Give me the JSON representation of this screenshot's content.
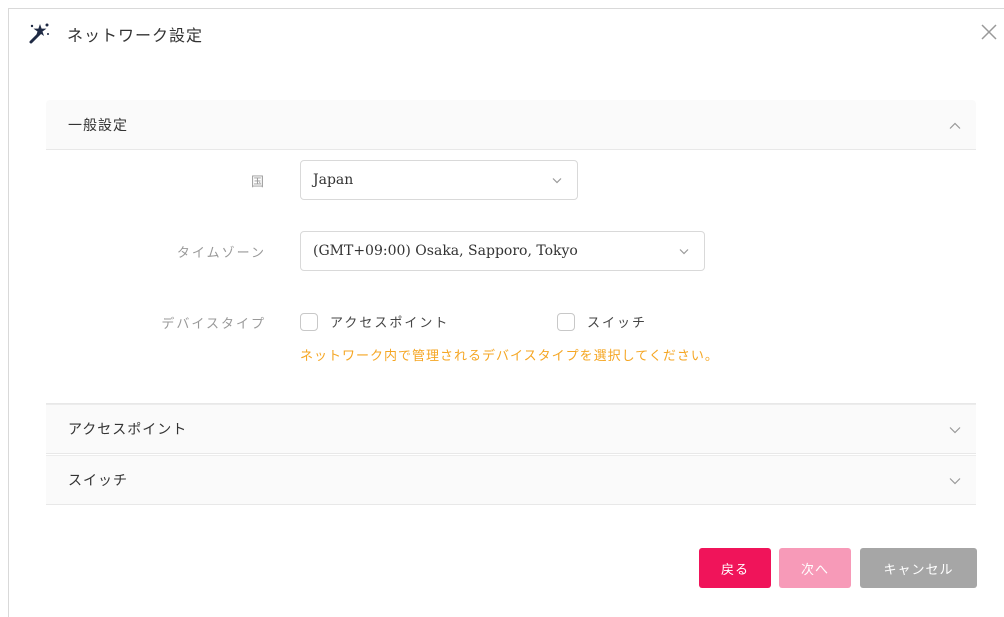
{
  "dialog": {
    "title": "ネットワーク設定",
    "icon": "magic-wand-icon",
    "close_icon": "close-icon"
  },
  "general_section": {
    "label": "一般設定",
    "expanded": true,
    "country": {
      "label": "国",
      "value": "Japan"
    },
    "timezone": {
      "label": "タイムゾーン",
      "value": "(GMT+09:00) Osaka, Sapporo, Tokyo"
    },
    "device_type": {
      "label": "デバイスタイプ",
      "options": [
        {
          "label": "アクセスポイント",
          "checked": false
        },
        {
          "label": "スイッチ",
          "checked": false
        }
      ],
      "hint": "ネットワーク内で管理されるデバイスタイプを選択してください。"
    }
  },
  "access_point_section": {
    "label": "アクセスポイント",
    "expanded": false
  },
  "switch_section": {
    "label": "スイッチ",
    "expanded": false
  },
  "buttons": {
    "back": "戻る",
    "next": "次へ",
    "cancel": "キャンセル"
  },
  "colors": {
    "primary": "#f0145a",
    "primary_disabled": "#f79ab8",
    "cancel": "#a6a6a6",
    "hint": "#f5a623"
  }
}
